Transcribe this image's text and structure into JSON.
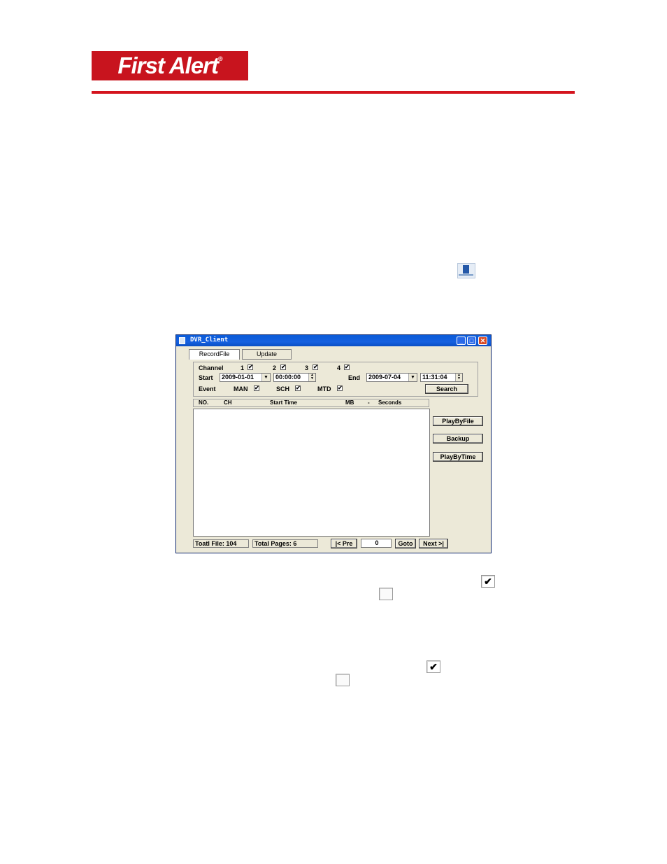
{
  "brand": {
    "logo_text": "First Alert",
    "logo_mark": "®",
    "accent": "#c8141e"
  },
  "window": {
    "title": "DVR_Client",
    "tabs": [
      "RecordFile",
      "Update"
    ],
    "channel_label": "Channel",
    "channels": [
      "1",
      "2",
      "3",
      "4"
    ],
    "start_label": "Start",
    "start_date": "2009-01-01",
    "start_time": "00:00:00",
    "end_label": "End",
    "end_date": "2009-07-04",
    "end_time": "11:31:04",
    "event_label": "Event",
    "events": [
      "MAN",
      "SCH",
      "MTD"
    ],
    "search_label": "Search",
    "columns": [
      "NO.",
      "CH",
      "Start Time",
      "MB",
      "-",
      "Seconds"
    ],
    "actions": [
      "PlayByFile",
      "Backup",
      "PlayByTime"
    ],
    "total_files": "Toatl File: 104",
    "total_pages": "Total Pages: 6",
    "prev_label": "|< Pre",
    "page_input": "0",
    "goto_label": "Goto",
    "next_label": "Next >|"
  },
  "icons": {
    "app_icon": "dvr-client-icon",
    "check_mark": "✔"
  }
}
